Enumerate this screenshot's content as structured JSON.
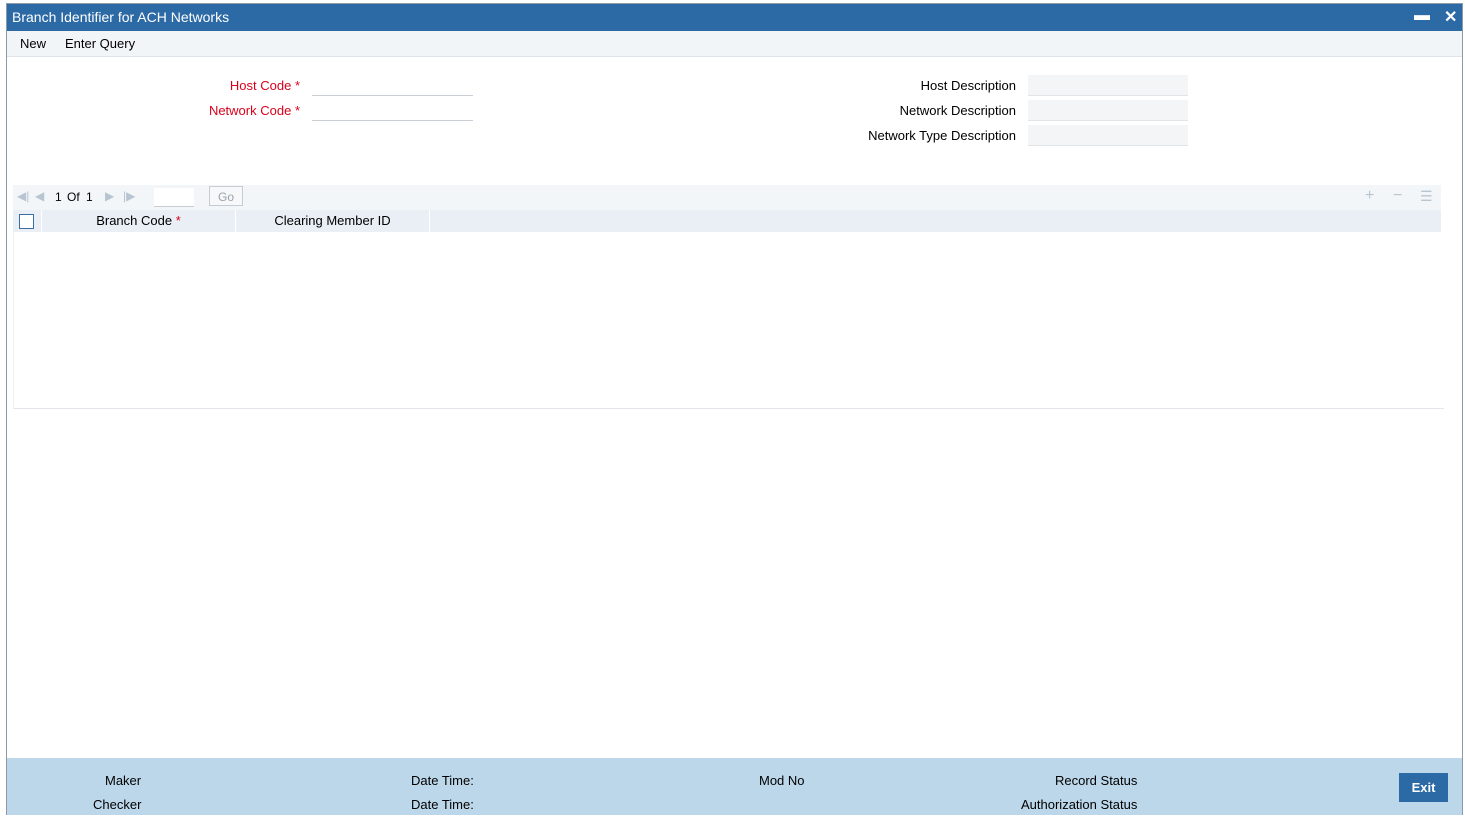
{
  "window": {
    "title": "Branch Identifier for ACH Networks",
    "minimize_glyph": "▬",
    "close_glyph": "✕"
  },
  "menu": {
    "new_label": "New",
    "enter_query_label": "Enter Query"
  },
  "form": {
    "host_code_label": "Host Code",
    "network_code_label": "Network Code",
    "required_mark": "*",
    "host_code_value": "",
    "network_code_value": "",
    "host_description_label": "Host Description",
    "network_description_label": "Network Description",
    "network_type_description_label": "Network Type Description",
    "host_description_value": "",
    "network_description_value": "",
    "network_type_description_value": ""
  },
  "grid": {
    "pagination": {
      "current": "1",
      "of_label": "Of",
      "total": "1",
      "go_label": "Go",
      "page_input": ""
    },
    "columns": [
      {
        "label": "Branch Code",
        "required": "*"
      },
      {
        "label": "Clearing Member ID"
      }
    ],
    "rows": []
  },
  "footer": {
    "maker_label": "Maker",
    "checker_label": "Checker",
    "date_time_label_1": "Date Time:",
    "date_time_label_2": "Date Time:",
    "mod_no_label": "Mod No",
    "record_status_label": "Record Status",
    "authorization_status_label": "Authorization Status",
    "exit_label": "Exit"
  },
  "colors": {
    "titlebar": "#2c6aa6",
    "required": "#d9001b",
    "footer": "#bcd7ea",
    "grid_header": "#e9eff5"
  },
  "icons": [
    "minimize-icon",
    "close-icon",
    "first-page-icon",
    "prev-page-icon",
    "next-page-icon",
    "last-page-icon",
    "add-row-icon",
    "delete-row-icon",
    "single-view-icon"
  ]
}
